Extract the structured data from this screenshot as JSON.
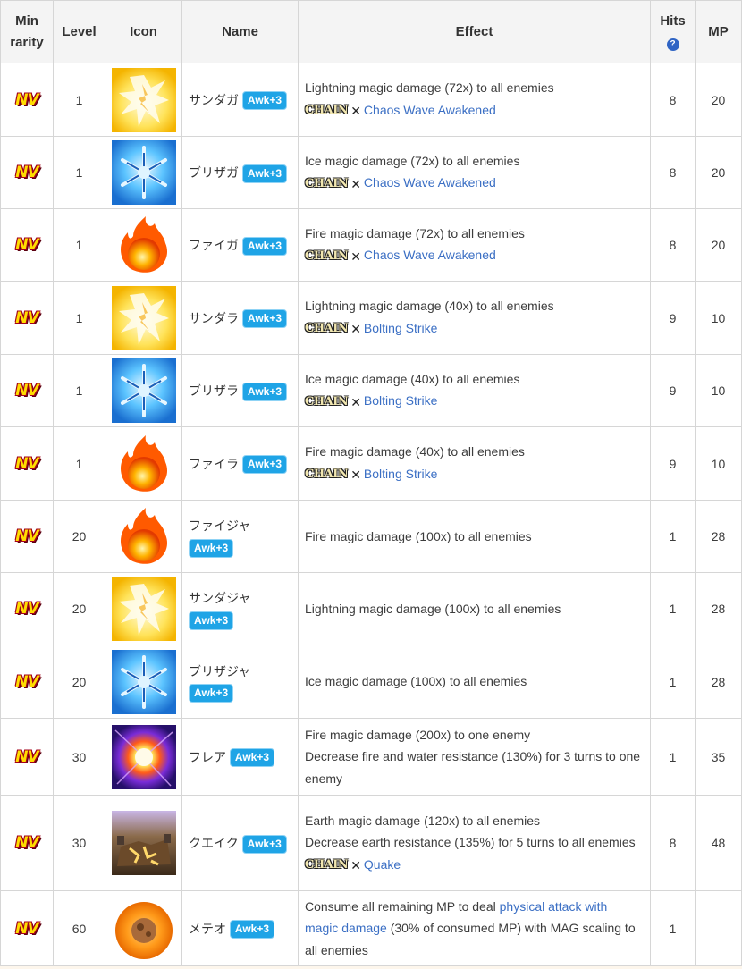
{
  "headers": {
    "min_rarity": "Min rarity",
    "level": "Level",
    "icon": "Icon",
    "name": "Name",
    "effect": "Effect",
    "hits": "Hits",
    "hits_help": "?",
    "mp": "MP"
  },
  "rarity_label": "NV",
  "awk_label": "Awk+3",
  "chain_label": "CHAIN",
  "chain_x": "✕",
  "rows": [
    {
      "level": "1",
      "icon": "lightning",
      "name": "サンダガ",
      "effect1": "Lightning magic damage (72x) to all enemies",
      "chain": "Chaos Wave Awakened",
      "hits": "8",
      "mp": "20"
    },
    {
      "level": "1",
      "icon": "ice",
      "name": "ブリザガ",
      "effect1": "Ice magic damage (72x) to all enemies",
      "chain": "Chaos Wave Awakened",
      "hits": "8",
      "mp": "20"
    },
    {
      "level": "1",
      "icon": "fire",
      "name": "ファイガ",
      "effect1": "Fire magic damage (72x) to all enemies",
      "chain": "Chaos Wave Awakened",
      "hits": "8",
      "mp": "20"
    },
    {
      "level": "1",
      "icon": "lightning",
      "name": "サンダラ",
      "effect1": "Lightning magic damage (40x) to all enemies",
      "chain": "Bolting Strike",
      "hits": "9",
      "mp": "10"
    },
    {
      "level": "1",
      "icon": "ice",
      "name": "ブリザラ",
      "effect1": "Ice magic damage (40x) to all enemies",
      "chain": "Bolting Strike",
      "hits": "9",
      "mp": "10"
    },
    {
      "level": "1",
      "icon": "fire",
      "name": "ファイラ",
      "effect1": "Fire magic damage (40x) to all enemies",
      "chain": "Bolting Strike",
      "hits": "9",
      "mp": "10"
    },
    {
      "level": "20",
      "icon": "fire",
      "name": "ファイジャ",
      "effect1": "Fire magic damage (100x) to all enemies",
      "hits": "1",
      "mp": "28"
    },
    {
      "level": "20",
      "icon": "lightning",
      "name": "サンダジャ",
      "effect1": "Lightning magic damage (100x) to all enemies",
      "hits": "1",
      "mp": "28"
    },
    {
      "level": "20",
      "icon": "ice",
      "name": "ブリザジャ",
      "effect1": "Ice magic damage (100x) to all enemies",
      "hits": "1",
      "mp": "28"
    },
    {
      "level": "30",
      "icon": "flare",
      "name": "フレア",
      "effect1": "Fire magic damage (200x) to one enemy",
      "effect2": "Decrease fire and water resistance (130%) for 3 turns to one enemy",
      "hits": "1",
      "mp": "35"
    },
    {
      "level": "30",
      "icon": "quake",
      "name": "クエイク",
      "effect1": "Earth magic damage (120x) to all enemies",
      "effect2": "Decrease earth resistance (135%) for 5 turns to all enemies",
      "chain": "Quake",
      "hits": "8",
      "mp": "48"
    },
    {
      "level": "60",
      "icon": "meteor",
      "name": "メテオ",
      "meteor_pre": "Consume all remaining MP to deal ",
      "meteor_link": "physical attack with magic damage",
      "meteor_post": " (30% of consumed MP) with MAG scaling to all enemies",
      "hits": "1",
      "mp": ""
    }
  ]
}
